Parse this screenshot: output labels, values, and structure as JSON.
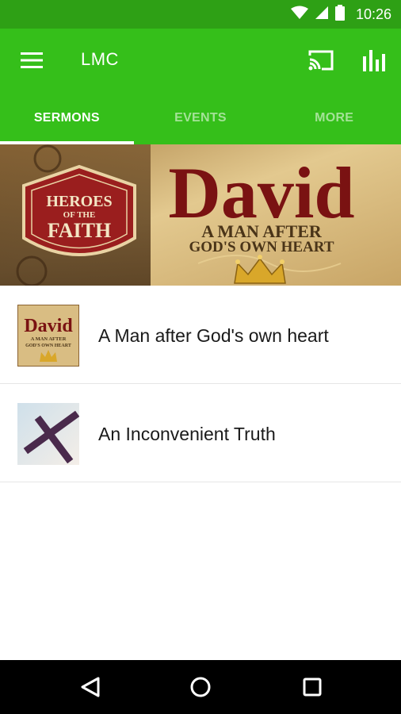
{
  "status_bar": {
    "time": "10:26",
    "icons": [
      "wifi-icon",
      "signal-icon",
      "battery-icon"
    ]
  },
  "app_bar": {
    "title": "LMC",
    "icons": [
      "menu-icon",
      "cast-icon",
      "bar-chart-icon"
    ]
  },
  "tabs": [
    {
      "label": "SERMONS",
      "active": true
    },
    {
      "label": "EVENTS",
      "active": false
    },
    {
      "label": "MORE",
      "active": false
    }
  ],
  "banner": {
    "badge_line1": "HEROES",
    "badge_line2": "OF THE",
    "badge_line3": "FAITH",
    "title": "David",
    "subtitle_line1": "A MAN AFTER",
    "subtitle_line2": "GOD'S OWN HEART"
  },
  "sermons": [
    {
      "title": "A Man after God's own heart",
      "thumb": {
        "title": "David",
        "line1": "A MAN AFTER",
        "line2": "GOD'S OWN HEART"
      }
    },
    {
      "title": "An Inconvenient Truth",
      "thumb": {}
    }
  ],
  "nav_bar": {
    "icons": [
      "back-icon",
      "home-icon",
      "recents-icon"
    ]
  },
  "colors": {
    "status_bar": "#2ea015",
    "app_bar": "#35bf1a",
    "tab_inactive": "rgba(255,255,255,0.55)",
    "banner_title": "#7a1212"
  }
}
